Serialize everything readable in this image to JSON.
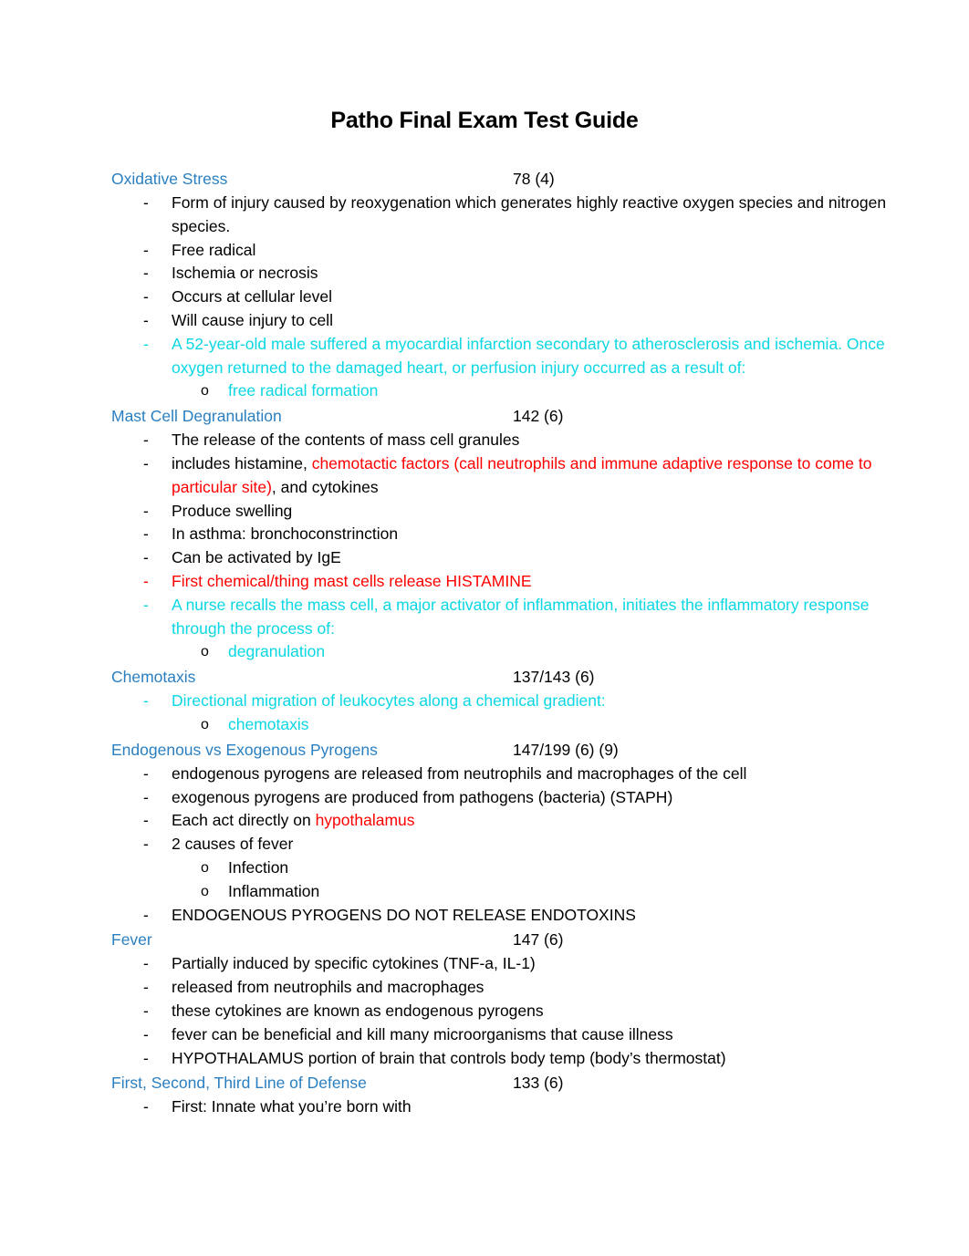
{
  "document": {
    "title": "Patho Final Exam Test Guide"
  },
  "colors": {
    "heading_blue": "#2a7fc0",
    "cyan": "#0ad7e3",
    "red": "#ff0000",
    "black": "#000000"
  },
  "markers": {
    "dash": "-",
    "circle": "o"
  },
  "sections": [
    {
      "heading": "Oxidative Stress",
      "page_ref": "78 (4)",
      "items": [
        {
          "level": 1,
          "marker_color": "black",
          "segments": [
            {
              "text": "Form of injury caused by reoxygenation which generates highly reactive oxygen species and nitrogen species.",
              "color": "black"
            }
          ]
        },
        {
          "level": 1,
          "marker_color": "black",
          "segments": [
            {
              "text": "Free radical",
              "color": "black"
            }
          ]
        },
        {
          "level": 1,
          "marker_color": "black",
          "segments": [
            {
              "text": "Ischemia or necrosis",
              "color": "black"
            }
          ]
        },
        {
          "level": 1,
          "marker_color": "black",
          "segments": [
            {
              "text": "Occurs at cellular level",
              "color": "black"
            }
          ]
        },
        {
          "level": 1,
          "marker_color": "black",
          "segments": [
            {
              "text": "Will cause injury to cell",
              "color": "black"
            }
          ]
        },
        {
          "level": 1,
          "marker_color": "cyan",
          "segments": [
            {
              "text": "A 52-year-old male suffered a myocardial infarction secondary to atherosclerosis and ischemia. Once oxygen returned to the damaged heart, or perfusion injury occurred as a result of:",
              "color": "cyan"
            }
          ]
        },
        {
          "level": 2,
          "marker_color": "black",
          "segments": [
            {
              "text": "free radical formation",
              "color": "cyan"
            }
          ]
        }
      ]
    },
    {
      "heading": "Mast Cell Degranulation",
      "page_ref": "142 (6)",
      "items": [
        {
          "level": 1,
          "marker_color": "black",
          "segments": [
            {
              "text": "The release of the contents of mass cell granules",
              "color": "black"
            }
          ]
        },
        {
          "level": 1,
          "marker_color": "black",
          "segments": [
            {
              "text": "includes histamine, ",
              "color": "black"
            },
            {
              "text": "chemotactic factors (call neutrophils and immune adaptive response to come to particular site)",
              "color": "red"
            },
            {
              "text": ", and cytokines",
              "color": "black"
            }
          ]
        },
        {
          "level": 1,
          "marker_color": "black",
          "segments": [
            {
              "text": "Produce swelling",
              "color": "black"
            }
          ]
        },
        {
          "level": 1,
          "marker_color": "black",
          "segments": [
            {
              "text": "In asthma: bronchoconstrinction",
              "color": "black"
            }
          ]
        },
        {
          "level": 1,
          "marker_color": "black",
          "segments": [
            {
              "text": "Can be activated by IgE",
              "color": "black"
            }
          ]
        },
        {
          "level": 1,
          "marker_color": "red",
          "segments": [
            {
              "text": "First chemical/thing mast cells release HISTAMINE",
              "color": "red"
            }
          ]
        },
        {
          "level": 1,
          "marker_color": "cyan",
          "segments": [
            {
              "text": "A nurse recalls the mass cell, a major activator of inflammation, initiates the inflammatory response through the process of:",
              "color": "cyan"
            }
          ]
        },
        {
          "level": 2,
          "marker_color": "black",
          "segments": [
            {
              "text": "degranulation",
              "color": "cyan"
            }
          ]
        }
      ]
    },
    {
      "heading": "Chemotaxis",
      "page_ref": "137/143 (6)",
      "items": [
        {
          "level": 1,
          "marker_color": "cyan",
          "segments": [
            {
              "text": "Directional migration of leukocytes along a chemical gradient:",
              "color": "cyan"
            }
          ]
        },
        {
          "level": 2,
          "marker_color": "black",
          "segments": [
            {
              "text": "chemotaxis",
              "color": "cyan"
            }
          ]
        }
      ]
    },
    {
      "heading": "Endogenous vs Exogenous Pyrogens",
      "page_ref": "147/199 (6) (9)",
      "items": [
        {
          "level": 1,
          "marker_color": "black",
          "segments": [
            {
              "text": "endogenous pyrogens are released from neutrophils and macrophages of the cell",
              "color": "black"
            }
          ]
        },
        {
          "level": 1,
          "marker_color": "black",
          "segments": [
            {
              "text": "exogenous pyrogens are produced from pathogens (bacteria) (STAPH)",
              "color": "black"
            }
          ]
        },
        {
          "level": 1,
          "marker_color": "black",
          "segments": [
            {
              "text": "Each act directly on ",
              "color": "black"
            },
            {
              "text": "hypothalamus",
              "color": "red"
            }
          ]
        },
        {
          "level": 1,
          "marker_color": "black",
          "segments": [
            {
              "text": "2 causes of fever",
              "color": "black"
            }
          ]
        },
        {
          "level": 2,
          "marker_color": "black",
          "segments": [
            {
              "text": "Infection",
              "color": "black"
            }
          ]
        },
        {
          "level": 2,
          "marker_color": "black",
          "segments": [
            {
              "text": "Inflammation",
              "color": "black"
            }
          ]
        },
        {
          "level": 1,
          "marker_color": "black",
          "segments": [
            {
              "text": "ENDOGENOUS PYROGENS DO NOT RELEASE ENDOTOXINS",
              "color": "black"
            }
          ]
        }
      ]
    },
    {
      "heading": "Fever",
      "page_ref": "147 (6)",
      "items": [
        {
          "level": 1,
          "marker_color": "black",
          "segments": [
            {
              "text": "Partially induced by specific cytokines (TNF-a, IL-1)",
              "color": "black"
            }
          ]
        },
        {
          "level": 1,
          "marker_color": "black",
          "segments": [
            {
              "text": "released from neutrophils and macrophages",
              "color": "black"
            }
          ]
        },
        {
          "level": 1,
          "marker_color": "black",
          "segments": [
            {
              "text": "these cytokines are known as endogenous pyrogens",
              "color": "black"
            }
          ]
        },
        {
          "level": 1,
          "marker_color": "black",
          "segments": [
            {
              "text": "fever can be beneficial and kill many microorganisms that cause illness",
              "color": "black"
            }
          ]
        },
        {
          "level": 1,
          "marker_color": "black",
          "segments": [
            {
              "text": "HYPOTHALAMUS portion of brain that controls body temp (body’s thermostat)",
              "color": "black"
            }
          ]
        }
      ]
    },
    {
      "heading": "First, Second, Third Line of Defense",
      "page_ref": "133 (6)",
      "items": [
        {
          "level": 1,
          "marker_color": "black",
          "segments": [
            {
              "text": "First: Innate what you’re born with",
              "color": "black"
            }
          ]
        }
      ]
    }
  ]
}
